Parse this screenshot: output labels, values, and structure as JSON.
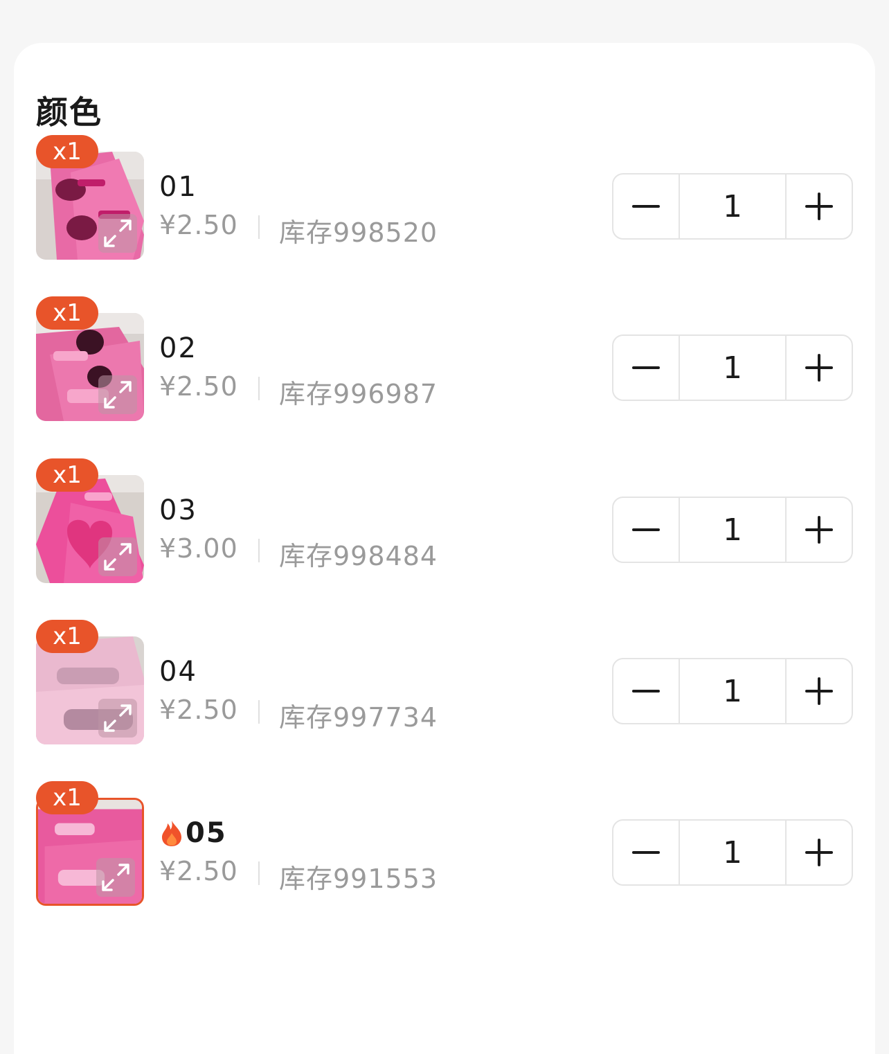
{
  "section_title": "颜色",
  "accent_color": "#e8542a",
  "items": [
    {
      "badge": "x1",
      "name": "01",
      "price": "¥2.50",
      "stock": "库存998520",
      "quantity": "1",
      "hot": false,
      "selected": false
    },
    {
      "badge": "x1",
      "name": "02",
      "price": "¥2.50",
      "stock": "库存996987",
      "quantity": "1",
      "hot": false,
      "selected": false
    },
    {
      "badge": "x1",
      "name": "03",
      "price": "¥3.00",
      "stock": "库存998484",
      "quantity": "1",
      "hot": false,
      "selected": false
    },
    {
      "badge": "x1",
      "name": "04",
      "price": "¥2.50",
      "stock": "库存997734",
      "quantity": "1",
      "hot": false,
      "selected": false
    },
    {
      "badge": "x1",
      "name": "05",
      "price": "¥2.50",
      "stock": "库存991553",
      "quantity": "1",
      "hot": true,
      "selected": true
    }
  ],
  "icons": {
    "minus": "minus-icon",
    "plus": "plus-icon",
    "expand": "expand-icon",
    "hot": "flame-icon"
  }
}
